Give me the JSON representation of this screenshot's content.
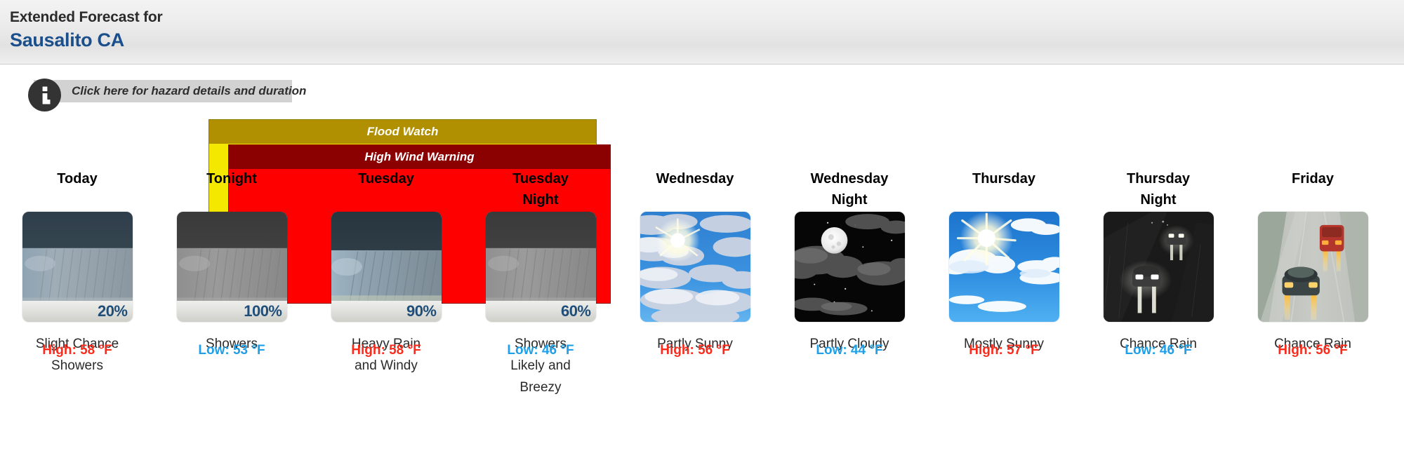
{
  "header": {
    "line1": "Extended Forecast for",
    "line2": "Sausalito CA",
    "accent_color": "#1a4f8b"
  },
  "hazard": {
    "icon": "info-circle-icon",
    "text": "Click here for hazard details and duration"
  },
  "alerts": [
    {
      "title": "Flood Watch",
      "header_color": "#b09000",
      "body_color": "#f5e800"
    },
    {
      "title": "High Wind Warning",
      "header_color": "#8b0000",
      "body_color": "#ff0000"
    }
  ],
  "forecast": {
    "high_color": "#fd2b1c",
    "low_color": "#1e9fe8",
    "periods": [
      {
        "day": "Today",
        "icon": "rain-showers-day-icon",
        "pop": "20%",
        "description": "Slight Chance\nShowers",
        "temp_label": "High: 58 °F",
        "temp_type": "high"
      },
      {
        "day": "Tonight",
        "icon": "rain-showers-night-icon",
        "pop": "100%",
        "description": "Showers",
        "temp_label": "Low: 53 °F",
        "temp_type": "low"
      },
      {
        "day": "Tuesday",
        "icon": "heavy-rain-windy-day-icon",
        "pop": "90%",
        "description": "Heavy Rain\nand Windy",
        "temp_label": "High: 58 °F",
        "temp_type": "high"
      },
      {
        "day": "Tuesday\nNight",
        "icon": "rain-showers-night-icon",
        "pop": "60%",
        "description": "Showers\nLikely and\nBreezy",
        "temp_label": "Low: 46 °F",
        "temp_type": "low"
      },
      {
        "day": "Wednesday",
        "icon": "partly-sunny-icon",
        "pop": "",
        "description": "Partly Sunny",
        "temp_label": "High: 56 °F",
        "temp_type": "high"
      },
      {
        "day": "Wednesday\nNight",
        "icon": "partly-cloudy-night-icon",
        "pop": "",
        "description": "Partly Cloudy",
        "temp_label": "Low: 44 °F",
        "temp_type": "low"
      },
      {
        "day": "Thursday",
        "icon": "mostly-sunny-icon",
        "pop": "",
        "description": "Mostly Sunny",
        "temp_label": "High: 57 °F",
        "temp_type": "high"
      },
      {
        "day": "Thursday\nNight",
        "icon": "chance-rain-night-icon",
        "pop": "",
        "description": "Chance Rain",
        "temp_label": "Low: 46 °F",
        "temp_type": "low"
      },
      {
        "day": "Friday",
        "icon": "chance-rain-day-icon",
        "pop": "",
        "description": "Chance Rain",
        "temp_label": "High: 56 °F",
        "temp_type": "high"
      }
    ]
  }
}
